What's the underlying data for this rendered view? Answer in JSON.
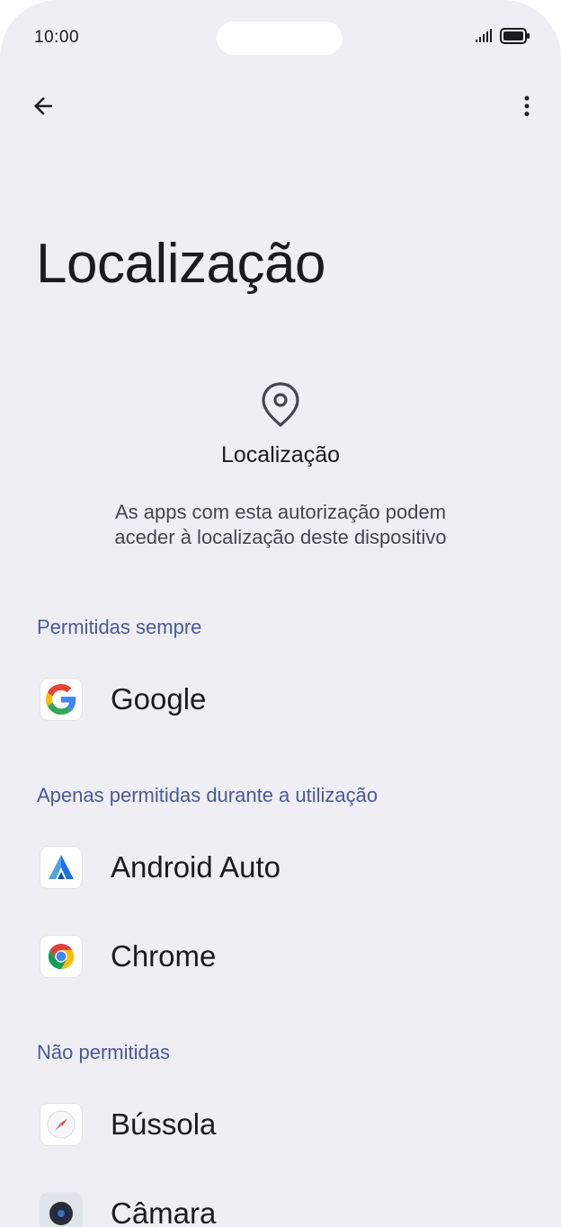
{
  "status_bar": {
    "time": "10:00"
  },
  "page": {
    "title": "Localização"
  },
  "hero": {
    "icon": "location-pin-icon",
    "title": "Localização",
    "description_line1": "As apps com esta autorização podem",
    "description_line2": "aceder à localização deste dispositivo"
  },
  "sections": {
    "always": {
      "header": "Permitidas sempre",
      "apps": [
        {
          "label": "Google",
          "icon": "google-icon"
        }
      ]
    },
    "while_using": {
      "header": "Apenas permitidas durante a utilização",
      "apps": [
        {
          "label": "Android Auto",
          "icon": "android-auto-icon"
        },
        {
          "label": "Chrome",
          "icon": "chrome-icon"
        }
      ]
    },
    "denied": {
      "header": "Não permitidas",
      "apps": [
        {
          "label": "Bússola",
          "icon": "compass-icon"
        },
        {
          "label": "Câmara",
          "icon": "camera-icon"
        }
      ]
    }
  },
  "colors": {
    "background": "#efeef5",
    "section_header": "#4a5a92",
    "text": "#1b1b1f"
  }
}
